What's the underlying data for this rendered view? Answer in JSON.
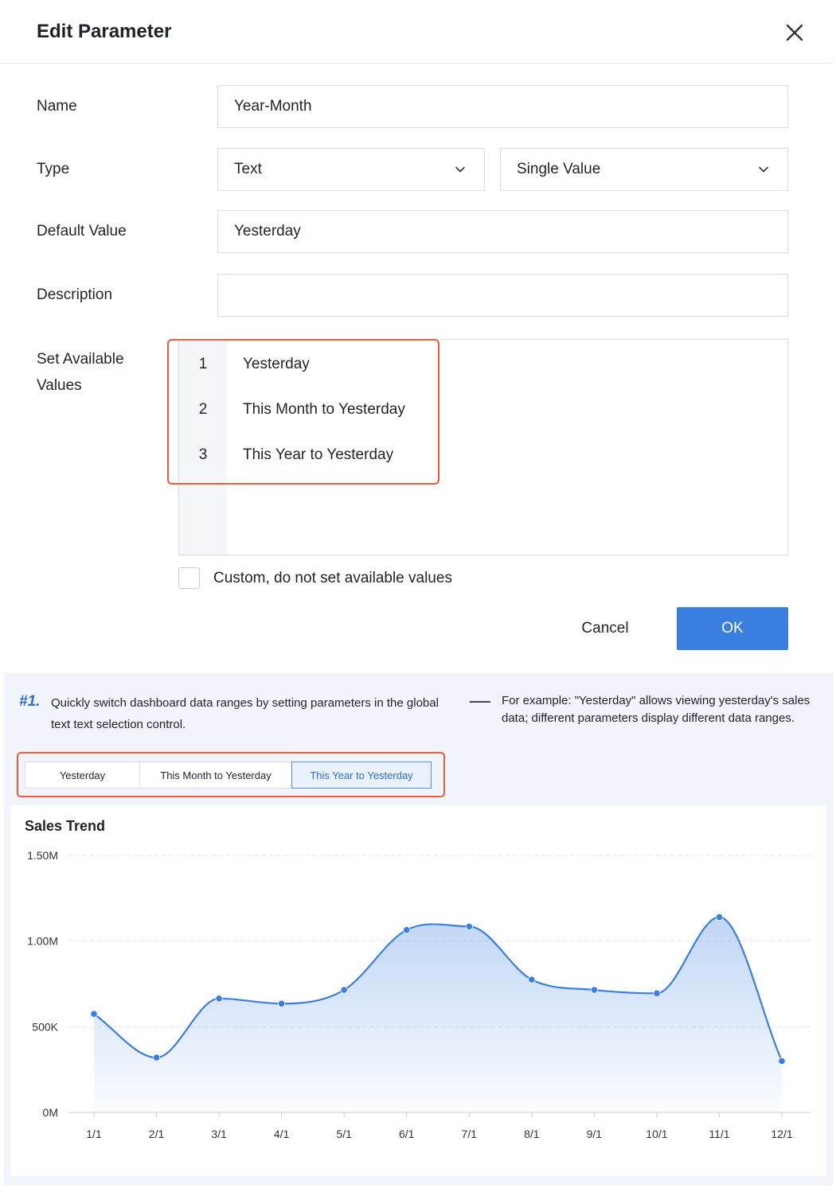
{
  "dialog": {
    "title": "Edit Parameter",
    "fields": {
      "name_label": "Name",
      "name_value": "Year-Month",
      "type_label": "Type",
      "type_value": "Text",
      "mode_value": "Single Value",
      "default_label": "Default Value",
      "default_value": "Yesterday",
      "description_label": "Description",
      "description_value": "",
      "available_label_line1": "Set Available",
      "available_label_line2": "Values"
    },
    "available_values": [
      {
        "num": "1",
        "text": "Yesterday"
      },
      {
        "num": "2",
        "text": "This Month to Yesterday"
      },
      {
        "num": "3",
        "text": "This Year to Yesterday"
      }
    ],
    "custom_checkbox_label": "Custom, do not set available values",
    "custom_checked": false,
    "cancel_label": "Cancel",
    "ok_label": "OK",
    "accent_color": "#3a7ee0",
    "highlight_color": "#ee5a3a"
  },
  "note": {
    "number": "#1.",
    "text": "Quickly switch dashboard data ranges by setting parameters in the global text text selection control.",
    "example": "For example: \"Yesterday\" allows viewing yesterday's sales data; different parameters display different data ranges."
  },
  "segment": {
    "options": [
      "Yesterday",
      "This Month to Yesterday",
      "This Year to Yesterday"
    ],
    "selected": "This Year to Yesterday"
  },
  "chart_data": {
    "type": "area",
    "title": "Sales Trend",
    "xlabel": "",
    "ylabel": "",
    "categories": [
      "1/1",
      "2/1",
      "3/1",
      "4/1",
      "5/1",
      "6/1",
      "7/1",
      "8/1",
      "9/1",
      "10/1",
      "11/1",
      "12/1"
    ],
    "values": [
      575000,
      320000,
      665000,
      635000,
      715000,
      1065000,
      1085000,
      775000,
      715000,
      695000,
      1140000,
      300000
    ],
    "y_ticks": [
      "0M",
      "500K",
      "1.00M",
      "1.50M"
    ],
    "ylim": [
      0,
      1500000
    ],
    "grid": true,
    "line_color": "#3a7ee0"
  }
}
